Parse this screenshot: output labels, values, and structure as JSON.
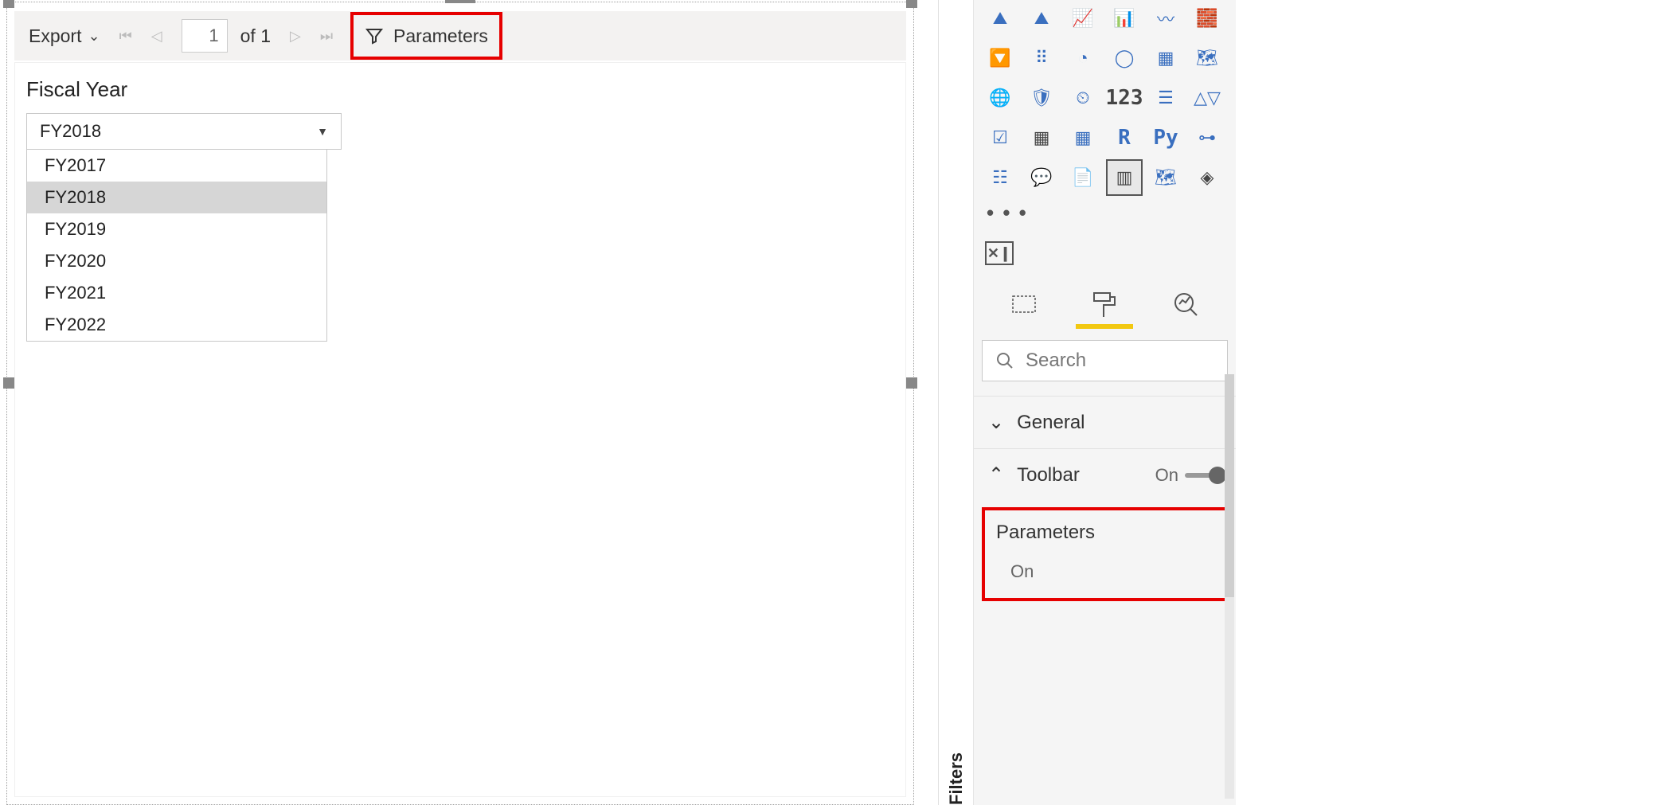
{
  "toolbar": {
    "export_label": "Export",
    "page_current": "1",
    "page_of_label": "of",
    "page_total": "1",
    "parameters_label": "Parameters"
  },
  "report": {
    "param_label": "Fiscal Year",
    "selected_value": "FY2018",
    "options": [
      "FY2017",
      "FY2018",
      "FY2019",
      "FY2020",
      "FY2021",
      "FY2022"
    ],
    "selected_index": 1
  },
  "filters": {
    "label": "Filters"
  },
  "viz_palette": {
    "r_label": "R",
    "py_label": "Py",
    "num_label": "123",
    "more": "• • •",
    "x_label": "✕❙"
  },
  "format_pane": {
    "search_placeholder": "Search",
    "general_label": "General",
    "toolbar_label": "Toolbar",
    "toolbar_state": "On",
    "parameters_label": "Parameters",
    "parameters_state": "On"
  }
}
